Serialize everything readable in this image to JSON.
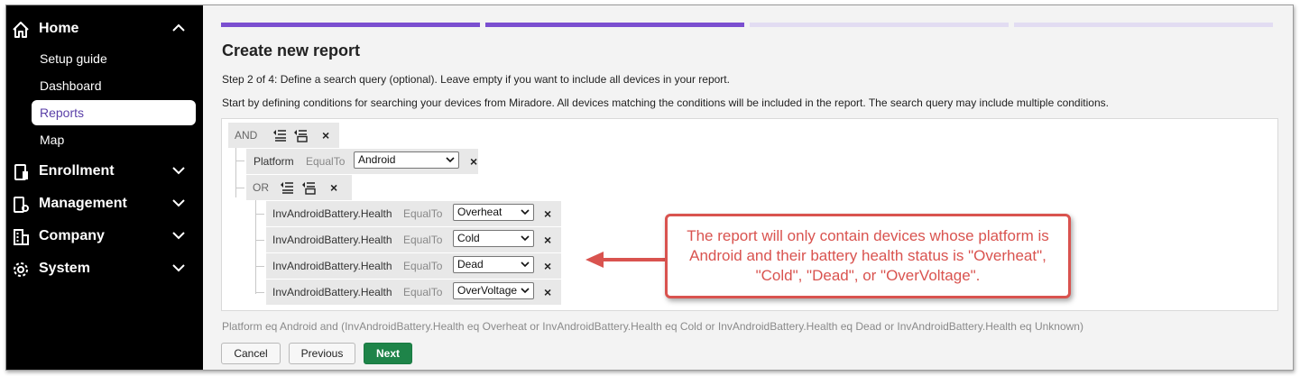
{
  "sidebar": {
    "sections": [
      {
        "label": "Home",
        "icon": "home-icon",
        "expanded": true
      },
      {
        "label": "Enrollment",
        "icon": "enrollment-icon",
        "expanded": false
      },
      {
        "label": "Management",
        "icon": "management-icon",
        "expanded": false
      },
      {
        "label": "Company",
        "icon": "company-icon",
        "expanded": false
      },
      {
        "label": "System",
        "icon": "settings-icon",
        "expanded": false
      }
    ],
    "home_items": [
      "Setup guide",
      "Dashboard",
      "Reports",
      "Map"
    ],
    "active_item": "Reports"
  },
  "wizard": {
    "total_steps": 4,
    "current_step": 2,
    "title": "Create new report",
    "step_text": "Step 2 of 4: Define a search query (optional). Leave empty if you want to include all devices in your report.",
    "description": "Start by defining conditions for searching your devices from Miradore. All devices matching the conditions will be included in the report. The search query may include multiple conditions."
  },
  "query": {
    "root_operator": "AND",
    "platform_condition": {
      "field": "Platform",
      "operator": "EqualTo",
      "value": "Android"
    },
    "group_operator": "OR",
    "group_conditions": [
      {
        "field": "InvAndroidBattery.Health",
        "operator": "EqualTo",
        "value": "Overheat"
      },
      {
        "field": "InvAndroidBattery.Health",
        "operator": "EqualTo",
        "value": "Cold"
      },
      {
        "field": "InvAndroidBattery.Health",
        "operator": "EqualTo",
        "value": "Dead"
      },
      {
        "field": "InvAndroidBattery.Health",
        "operator": "EqualTo",
        "value": "OverVoltage"
      }
    ],
    "remove_symbol": "×"
  },
  "summary": "Platform eq Android and (InvAndroidBattery.Health eq Overheat or InvAndroidBattery.Health eq Cold or InvAndroidBattery.Health eq Dead or InvAndroidBattery.Health eq Unknown)",
  "buttons": {
    "cancel": "Cancel",
    "previous": "Previous",
    "next": "Next"
  },
  "callout": "The report will only contain devices whose platform is Android and their battery health status is \"Overheat\", \"Cold\", \"Dead\", or \"OverVoltage\".",
  "colors": {
    "accent": "#7b4fd0",
    "accent_light": "#e2dcf2",
    "next_button": "#1e8449",
    "callout": "#d9534f",
    "active_text": "#5a3fa8"
  }
}
